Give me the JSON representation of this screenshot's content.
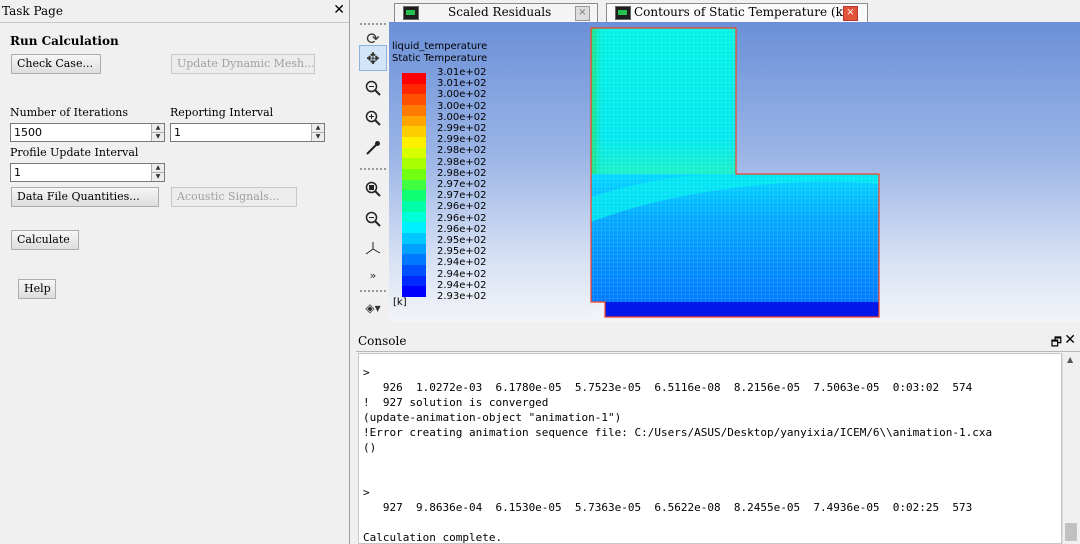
{
  "task_page": {
    "title": "Task Page",
    "close": "✕",
    "section_title": "Run Calculation",
    "check_case_label": "Check Case...",
    "update_dynamic_mesh_label": "Update Dynamic Mesh...",
    "iterations_label": "Number of Iterations",
    "iterations_value": "1500",
    "reporting_interval_label": "Reporting Interval",
    "reporting_interval_value": "1",
    "profile_update_label": "Profile Update Interval",
    "profile_update_value": "1",
    "data_file_quantities_label": "Data File Quantities...",
    "acoustic_signals_label": "Acoustic Signals...",
    "calculate_label": "Calculate",
    "help_label": "Help"
  },
  "tabs": [
    {
      "label": "Scaled Residuals",
      "active": false,
      "close": "×"
    },
    {
      "label": "Contours of Static Temperature (k)",
      "active": true,
      "close": "×"
    }
  ],
  "toolbar": {
    "icons": [
      "rotate-icon",
      "pan-icon",
      "zoom-fit-icon",
      "zoom-in-icon",
      "probe-icon",
      "zoom-box-icon",
      "zoom-out-icon",
      "axes-icon",
      "more-icon",
      "view-options-icon"
    ]
  },
  "legend": {
    "title_line1": "liquid_temperature",
    "title_line2": "Static Temperature",
    "unit": "[k]",
    "levels": [
      "3.01e+02",
      "3.01e+02",
      "3.00e+02",
      "3.00e+02",
      "3.00e+02",
      "2.99e+02",
      "2.99e+02",
      "2.98e+02",
      "2.98e+02",
      "2.98e+02",
      "2.97e+02",
      "2.97e+02",
      "2.96e+02",
      "2.96e+02",
      "2.96e+02",
      "2.95e+02",
      "2.95e+02",
      "2.94e+02",
      "2.94e+02",
      "2.94e+02",
      "2.93e+02"
    ],
    "colors": [
      "#ff0000",
      "#ff2600",
      "#ff5000",
      "#ff7a00",
      "#ffa400",
      "#ffcc00",
      "#fff000",
      "#d8ff00",
      "#a8ff00",
      "#72ff10",
      "#40ff40",
      "#10ff72",
      "#00ffa8",
      "#00ffd8",
      "#00f0ff",
      "#00c8ff",
      "#00a0ff",
      "#0078ff",
      "#0050ff",
      "#0028ff",
      "#0000ff"
    ]
  },
  "console": {
    "title": "Console",
    "restore": "🗗",
    "close": "✕",
    "lines": [
      ">",
      "   926  1.0272e-03  6.1780e-05  5.7523e-05  6.5116e-08  8.2156e-05  7.5063e-05  0:03:02  574",
      "!  927 solution is converged",
      "(update-animation-object \"animation-1\")",
      "!Error creating animation sequence file: C:/Users/ASUS/Desktop/yanyixia/ICEM/6\\\\animation-1.cxa",
      "()",
      "",
      "",
      ">",
      "   927  9.8636e-04  6.1530e-05  5.7363e-05  6.5622e-08  8.2455e-05  7.4936e-05  0:02:25  573",
      "",
      "Calculation complete."
    ]
  }
}
